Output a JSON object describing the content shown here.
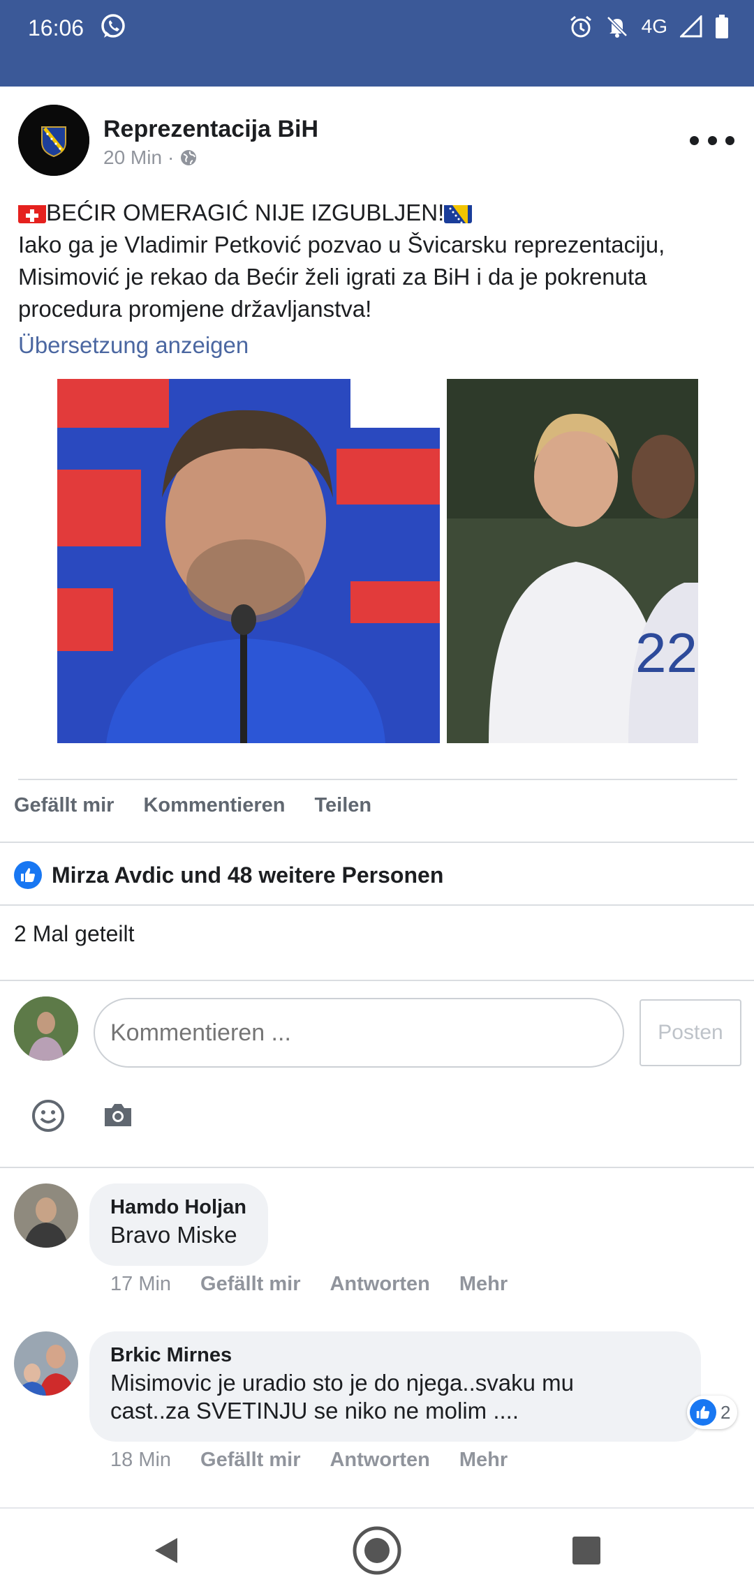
{
  "status_bar": {
    "time": "16:06",
    "network": "4G",
    "icons": [
      "whatsapp-icon",
      "alarm-icon",
      "notifications-off-icon",
      "signal-icon",
      "battery-icon"
    ],
    "background": "#3b5998"
  },
  "post": {
    "page_name": "Reprezentacija BiH",
    "time": "20 Min",
    "audience_icon": "globe-icon",
    "text_lines": [
      "BEĆIR OMERAGIĆ NIJE IZGUBLJEN!",
      "Iako ga je Vladimir Petković pozvao u Švicarsku reprezentaciju,",
      "Misimović je rekao da Bećir želi igrati za BiH i da je pokrenuta",
      "procedura promjene državljanstva!"
    ],
    "translate_link": "Übersetzung anzeigen",
    "image_panels": [
      "press-conference-photo",
      "football-match-photo"
    ]
  },
  "actions": {
    "like": "Gefällt mir",
    "comment": "Kommentieren",
    "share": "Teilen"
  },
  "reactions": {
    "summary": "Mirza Avdic und 48 weitere Personen",
    "shares": "2 Mal geteilt"
  },
  "composer": {
    "placeholder": "Kommentieren ...",
    "post_button": "Posten"
  },
  "comments": [
    {
      "author": "Hamdo Holjan",
      "text_lines": [
        "Bravo Miske"
      ],
      "time": "17 Min",
      "like": "Gefällt mir",
      "reply": "Antworten",
      "more": "Mehr"
    },
    {
      "author": "Brkic Mirnes",
      "text_lines": [
        "Misimovic je uradio sto je do njega..svaku mu",
        "cast..za SVETINJU se niko ne molim ...."
      ],
      "time": "18 Min",
      "like": "Gefällt mir",
      "reply": "Antworten",
      "more": "Mehr",
      "reaction_count": "2"
    }
  ],
  "colors": {
    "brand": "#3b5998",
    "link": "#4b67a1",
    "like_blue": "#1877f2",
    "muted": "#90949c"
  }
}
